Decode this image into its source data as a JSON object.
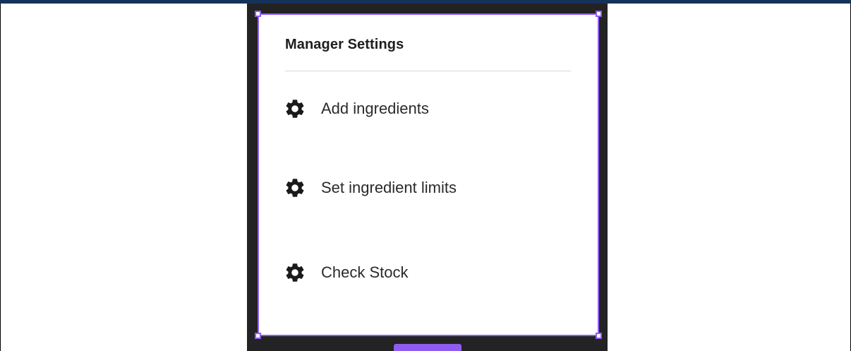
{
  "panel": {
    "title": "Manager Settings",
    "items": [
      {
        "label": "Add ingredients",
        "icon": "gear-icon"
      },
      {
        "label": "Set ingredient limits",
        "icon": "gear-icon"
      },
      {
        "label": "Check Stock",
        "icon": "gear-icon"
      }
    ]
  },
  "editor": {
    "size_badge": ""
  },
  "colors": {
    "selection": "#8f5cf0",
    "canvas": "#232323",
    "top_strip": "#16325a",
    "text": "#2a2a2a"
  }
}
